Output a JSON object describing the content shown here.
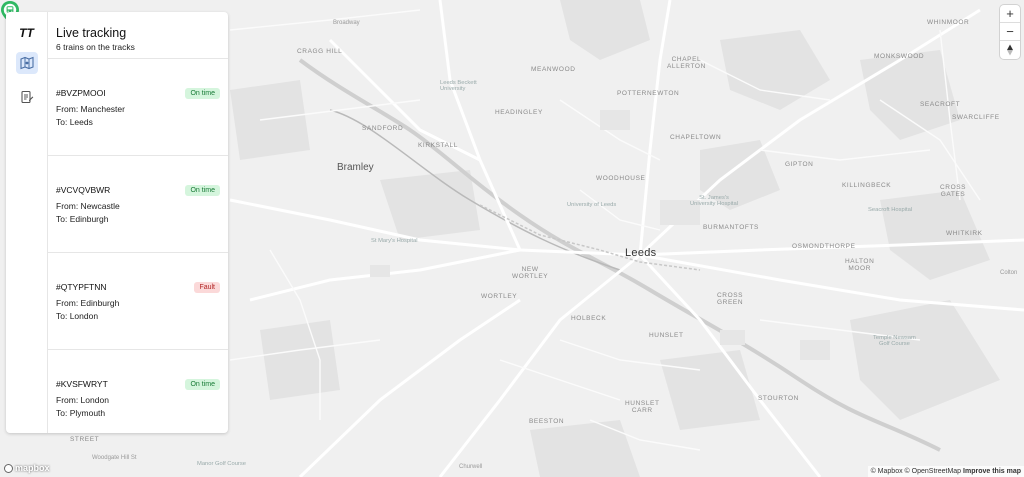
{
  "app": {
    "logo": "TT"
  },
  "panel": {
    "title": "Live tracking",
    "subtitle": "6 trains on the tracks",
    "nav": [
      {
        "icon": "map-icon",
        "active": true
      },
      {
        "icon": "report-icon",
        "active": false
      }
    ],
    "trains": [
      {
        "id": "#BVZPMOOI",
        "status": "On time",
        "status_kind": "ok",
        "from": "From: Manchester",
        "to": "To: Leeds"
      },
      {
        "id": "#VCVQVBWR",
        "status": "On time",
        "status_kind": "ok",
        "from": "From: Newcastle",
        "to": "To: Edinburgh"
      },
      {
        "id": "#QTYPFTNN",
        "status": "Fault",
        "status_kind": "fault",
        "from": "From: Edinburgh",
        "to": "To: London"
      },
      {
        "id": "#KVSFWRYT",
        "status": "On time",
        "status_kind": "ok",
        "from": "From: London",
        "to": "To: Plymouth"
      }
    ]
  },
  "map": {
    "controls": {
      "zoom_in": "+",
      "zoom_out": "−"
    },
    "labels": {
      "broadway": "Broadway",
      "cragg_hill": "CRAGG HILL",
      "sandford": "SANDFORD",
      "bramley": "Bramley",
      "kirkstall": "KIRKSTALL",
      "headingley": "HEADINGLEY",
      "meanwood": "MEANWOOD",
      "leeds_beckett": "Leeds Beckett\nUniversity",
      "chapel_allerton": "CHAPEL\nALLERTON",
      "potternewton": "POTTERNEWTON",
      "chapeltown": "CHAPELTOWN",
      "whinmoor": "WHINMOOR",
      "monkswood": "MONKSWOOD",
      "seacroft": "SEACROFT",
      "swarcliffe": "SWARCLIFFE",
      "woodhouse": "WOODHOUSE",
      "gipton": "GIPTON",
      "killingbeck": "KILLINGBECK",
      "cross_gates": "CROSS\nGATES",
      "univ_leeds": "University of Leeds",
      "st_james": "St. James's\nUniversity Hospital",
      "seacroft_hospital": "Seacroft Hospital",
      "burmantofts": "BURMANTOFTS",
      "whitkirk": "WHITKIRK",
      "osmondthorpe": "OSMONDTHORPE",
      "leeds": "Leeds",
      "st_marys": "St Mary's Hospital",
      "new_wortley": "NEW\nWORTLEY",
      "wortley": "WORTLEY",
      "halton_moor": "HALTON\nMOOR",
      "colton": "Colton",
      "holbeck": "HOLBECK",
      "hunslet": "HUNSLET",
      "cross_green": "CROSS\nGREEN",
      "temple_newsam": "Temple Newsam\nGolf Course",
      "stourton": "STOURTON",
      "beeston": "BEESTON",
      "hunslet_carr": "HUNSLET\nCARR",
      "manor_golf": "Manor Golf Course",
      "churwell": "Churwell",
      "street": "STREET",
      "morley_hill": "Woodgate Hill St"
    },
    "attribution": {
      "mapbox": "© Mapbox",
      "osm": "© OpenStreetMap",
      "improve": "Improve this map"
    },
    "brand": "mapbox"
  }
}
